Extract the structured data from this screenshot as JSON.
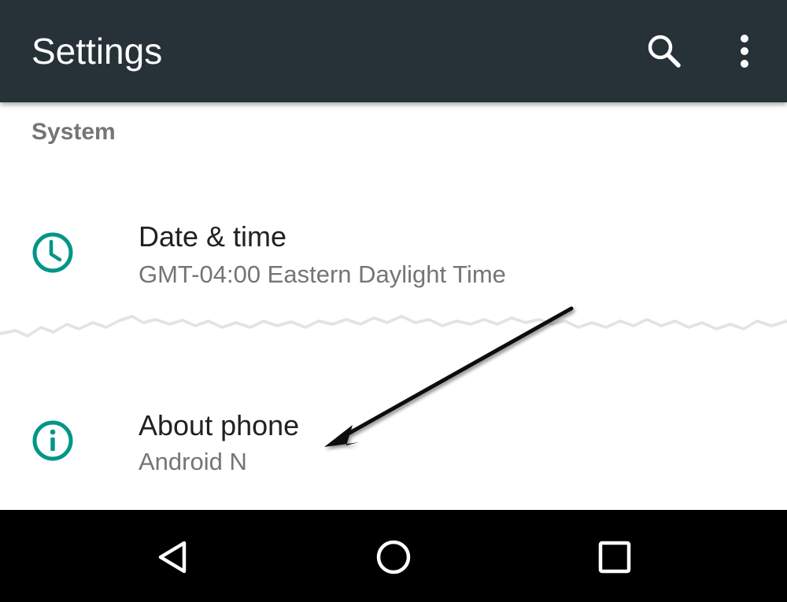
{
  "toolbar": {
    "title": "Settings",
    "search_icon": "search-icon",
    "overflow_icon": "more-vert-icon",
    "background": "#263238"
  },
  "section": {
    "header": "System"
  },
  "items": [
    {
      "title": "Date & time",
      "summary": "GMT-04:00 Eastern Daylight Time",
      "icon": "clock-icon"
    },
    {
      "title": "About phone",
      "summary": "Android N",
      "icon": "info-icon"
    }
  ],
  "colors": {
    "accent": "#009688",
    "title_text": "#212121",
    "summary_text": "#757575",
    "navbar": "#000000"
  },
  "navbar": {
    "back_icon": "back-triangle-icon",
    "home_icon": "home-circle-icon",
    "recents_icon": "recents-square-icon"
  }
}
